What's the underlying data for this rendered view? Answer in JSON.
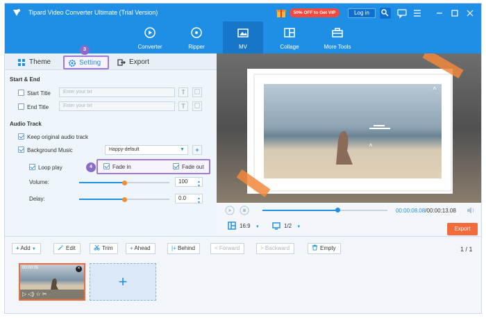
{
  "titlebar": {
    "app_title": "Tipard Video Converter Ultimate (Trial Version)",
    "vip_badge": "50% OFF to Get VIP",
    "login_label": "Log in",
    "icons": [
      "gift-icon",
      "key-icon",
      "chat-icon",
      "menu-icon",
      "minimize-icon",
      "maximize-icon",
      "close-icon"
    ]
  },
  "nav": {
    "tabs": [
      {
        "label": "Converter",
        "icon": "converter-icon"
      },
      {
        "label": "Ripper",
        "icon": "ripper-icon"
      },
      {
        "label": "MV",
        "icon": "mv-icon",
        "active": true
      },
      {
        "label": "Collage",
        "icon": "collage-icon"
      },
      {
        "label": "More Tools",
        "icon": "toolbox-icon"
      }
    ]
  },
  "subtabs": {
    "theme": "Theme",
    "setting": "Setting",
    "export": "Export",
    "setting_step": "3"
  },
  "start_end": {
    "heading": "Start & End",
    "start_title_label": "Start Title",
    "start_title_placeholder": "Enter your txt",
    "end_title_label": "End Title",
    "end_title_placeholder": "Enter your txt",
    "text_button": "T"
  },
  "audio": {
    "heading": "Audio Track",
    "keep_original": "Keep original audio track",
    "background_music": "Background Music",
    "music_selected": "Happy-default",
    "add_button": "+",
    "loop_play": "Loop play",
    "step": "4",
    "fade_in": "Fade in",
    "fade_out": "Fade out",
    "volume_label": "Volume:",
    "volume_value": "100",
    "volume_level": 0.5,
    "delay_label": "Delay:",
    "delay_value": "0.0",
    "delay_level": 0.5
  },
  "player": {
    "time_current": "00:00:08.08",
    "time_total": "00:00:13.08",
    "progress": 0.6,
    "aspect": "16:9",
    "screen": "1/2",
    "export_label": "Export"
  },
  "timeline": {
    "add": "Add",
    "edit": "Edit",
    "trim": "Trim",
    "ahead": "Ahead",
    "behind": "Behind",
    "forward": "Forward",
    "backward": "Backward",
    "empty": "Empty",
    "page": "1",
    "page_total": "1",
    "clip_duration": "00:00:05",
    "add_clip": "+"
  },
  "colors": {
    "accent": "#1f8fe5",
    "export": "#f26b3a",
    "highlight": "#9b7bd4",
    "vip": "#f24a3e"
  }
}
